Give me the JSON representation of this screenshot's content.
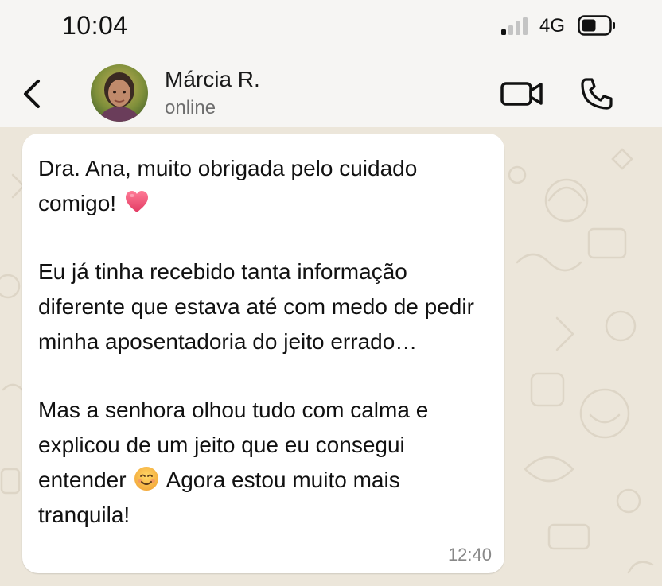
{
  "status_bar": {
    "time": "10:04",
    "network": "4G",
    "signal_icon": "signal-bars-icon",
    "battery_icon": "battery-icon"
  },
  "header": {
    "back_icon": "chevron-left-icon",
    "contact_name": "Márcia R.",
    "contact_status": "online",
    "video_icon": "video-camera-icon",
    "call_icon": "phone-icon"
  },
  "message": {
    "p1_text": "Dra. Ana, muito obrigada pelo cuidado comigo!",
    "p1_emoji": "heart-emoji",
    "p2_text": "Eu já tinha recebido tanta informação diferente que estava até com medo de pedir minha aposentadoria do jeito errado…",
    "p3_text_before": "Mas a senhora olhou tudo com calma e explicou de um jeito que eu consegui entender",
    "p3_emoji": "smiling-face-emoji",
    "p3_text_after": "Agora estou muito mais tranquila!",
    "time": "12:40"
  },
  "colors": {
    "background": "#f6f5f3",
    "chat_wallpaper": "#ece6da",
    "bubble": "#ffffff",
    "heart": "#f0506e",
    "smile": "#f7b94a"
  }
}
